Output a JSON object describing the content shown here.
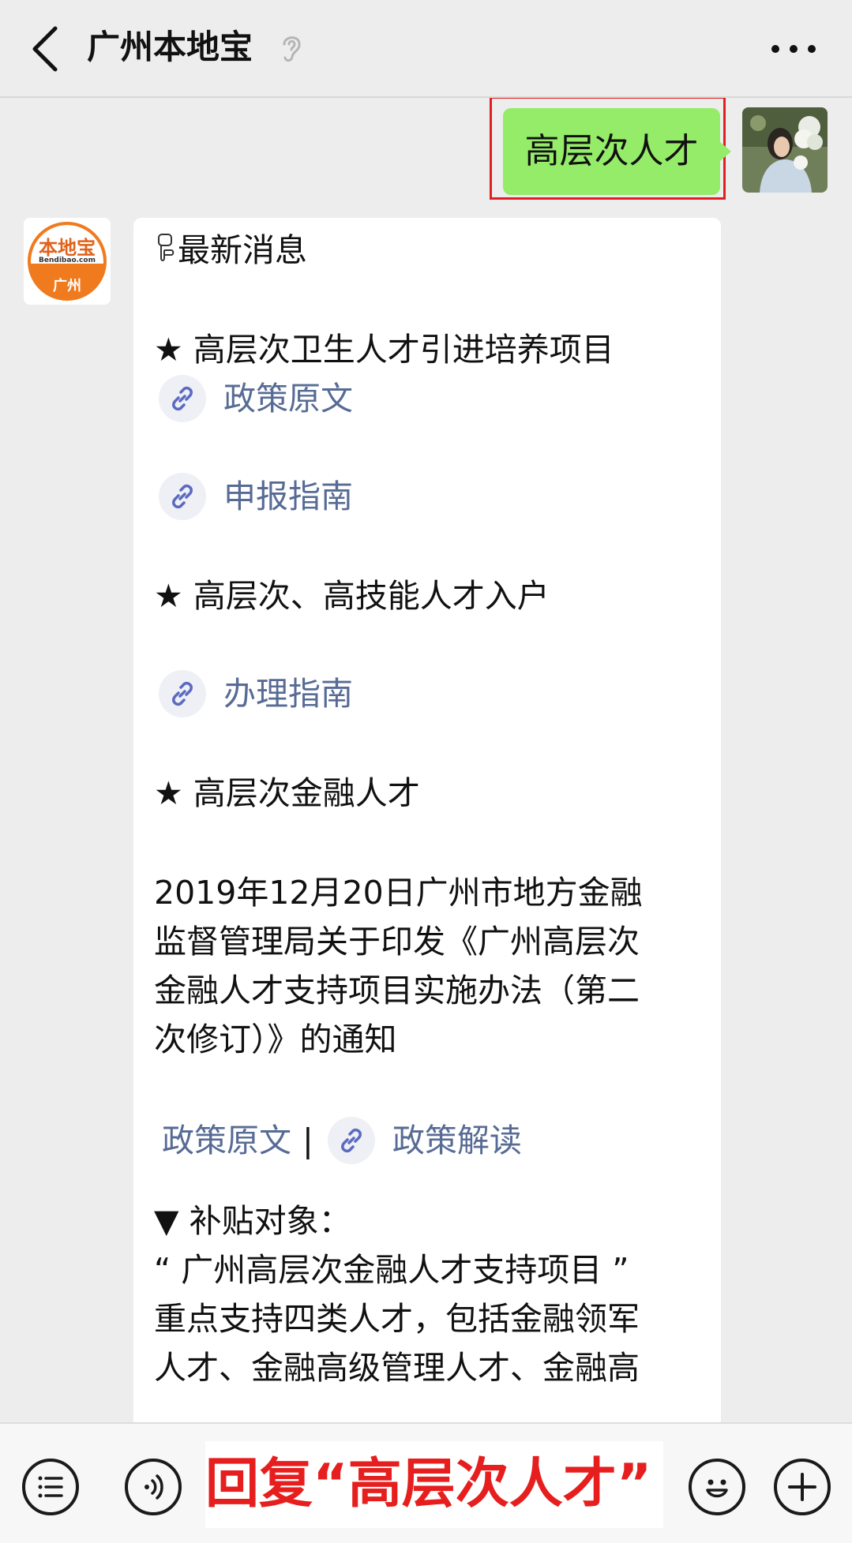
{
  "header": {
    "title": "广州本地宝"
  },
  "user_message": {
    "text": "高层次人才"
  },
  "bot_avatar": {
    "logo_top": "本地宝",
    "logo_mid": "Bendibao.com",
    "logo_bottom": "广州"
  },
  "bot_message": {
    "latest": "最新消息",
    "section1_title": "★ 高层次卫生人才引进培养项目",
    "section1_link1": "政策原文",
    "section1_link2": "申报指南",
    "section2_title": "★ 高层次、高技能人才入户",
    "section2_link1": "办理指南",
    "section3_title": "★ 高层次金融人才",
    "notice_line1": "2019年12月20日广州市地方金融",
    "notice_line2": "监督管理局关于印发《广州高层次",
    "notice_line3": "金融人才支持项目实施办法（第二",
    "notice_line4": "次修订）》的通知",
    "link_policy": "政策原文",
    "pipe": "|",
    "link_interpret": "政策解读",
    "subsidy_title": "▼ 补贴对象：",
    "subsidy_line1": "“ 广州高层次金融人才支持项目 ”",
    "subsidy_line2": "重点支持四类人才，包括金融领军",
    "subsidy_line3": "人才、金融高级管理人才、金融高"
  },
  "toolbar": {
    "overlay_text": "回复“高层次人才”"
  },
  "colors": {
    "background": "#ededed",
    "user_bubble": "#95ec69",
    "link": "#576b95",
    "highlight_red": "#e02020",
    "logo_orange": "#f07a1e"
  }
}
